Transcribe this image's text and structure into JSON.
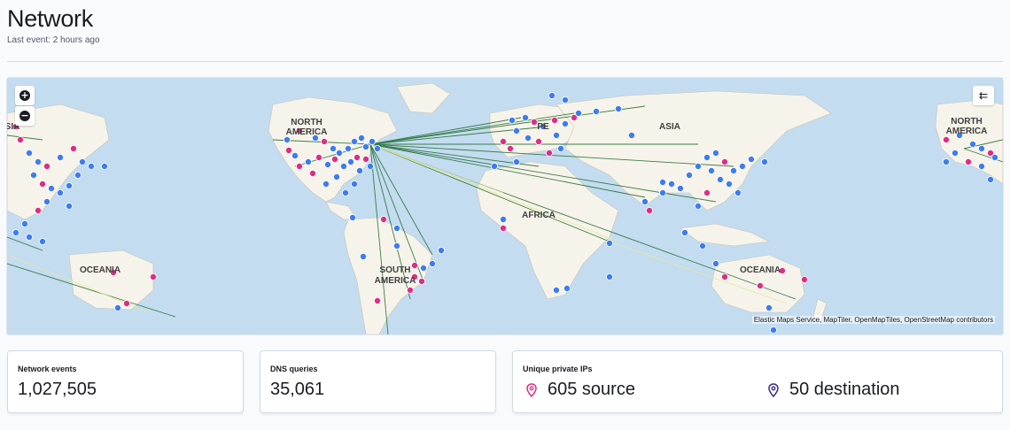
{
  "header": {
    "title": "Network",
    "last_event": "Last event: 2 hours ago"
  },
  "map": {
    "attribution": "Elastic Maps Service, MapTiler, OpenMapTiles, OpenStreetMap contributors",
    "zoom_in_icon": "plus-icon",
    "zoom_out_icon": "minus-icon",
    "layers_icon": "layers-icon",
    "labels": {
      "north_america": "NORTH AMERICA",
      "north_america_right": "NORTH AMERICA",
      "asia": "ASIA",
      "europe_partial": "PE",
      "asia_left_partial": "SIA",
      "africa": "AFRICA",
      "south_america": "SOUTH AMERICA",
      "oceania": "OCEANIA",
      "oceania_right": "OCEANIA"
    },
    "colors": {
      "ocean": "#c3dcf0",
      "land": "#f6f3ea",
      "source_point": "#dd2e84",
      "destination_point": "#3d7cf0",
      "line_primary": "#1f6b2c",
      "line_secondary": "#e3ea9a"
    }
  },
  "stats": {
    "network_events": {
      "title": "Network events",
      "value": "1,027,505"
    },
    "dns_queries": {
      "title": "DNS queries",
      "value": "35,061"
    },
    "unique_private_ips": {
      "title": "Unique private IPs",
      "source": "605 source",
      "destination": "50 destination",
      "source_icon": "map-marker-icon",
      "destination_icon": "map-marker-icon",
      "source_color": "#dd2e84",
      "destination_color": "#3d2a8a"
    }
  }
}
